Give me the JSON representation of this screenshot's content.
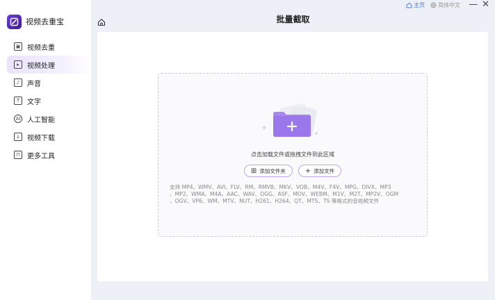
{
  "app": {
    "name": "视频去重宝"
  },
  "window": {
    "home_link": "主页",
    "language": "简体中文",
    "minimize": "—",
    "close": "✕"
  },
  "sidebar": {
    "items": [
      {
        "label": "视频去重",
        "icon": "video-dedupe-icon",
        "active": false
      },
      {
        "label": "视频处理",
        "icon": "video-process-icon",
        "active": true
      },
      {
        "label": "声音",
        "icon": "audio-icon",
        "active": false
      },
      {
        "label": "文字",
        "icon": "text-icon",
        "active": false
      },
      {
        "label": "人工智能",
        "icon": "ai-icon",
        "active": false
      },
      {
        "label": "视频下载",
        "icon": "download-icon",
        "active": false
      },
      {
        "label": "更多工具",
        "icon": "toolbox-icon",
        "active": false
      }
    ]
  },
  "header": {
    "title": "批量截取"
  },
  "dropzone": {
    "hint": "点击加载文件或拖拽文件到此区域",
    "add_folder": "添加文件夹",
    "add_file": "添加文件",
    "formats_line1": "支持 MP4、WMV、AVI、FLV、RM、RMVB、MKV、VOB、M4V、F4V、MPG、DIVX、MP3",
    "formats_line2": "、MP2、WMA、M4A、AAC、WAV、OGG、ASF、MOV、WEBM、M1V、M2T、MP2V、OGM",
    "formats_line3": "、OGV、VP6、WM、MTV、NUT、H261、H264、QT、MTS、TS 等格式的音视频文件"
  },
  "colors": {
    "accent": "#8b6cf0",
    "sidebar_active": "#ece7fc",
    "background": "#eef0f7"
  }
}
